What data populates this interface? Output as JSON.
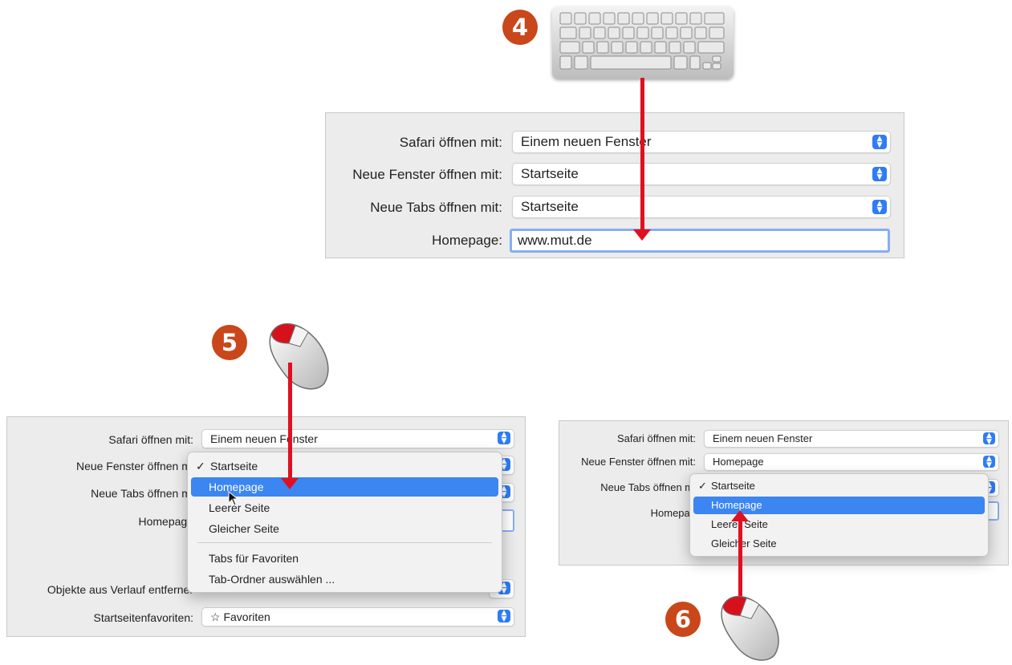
{
  "steps": {
    "four": "4",
    "five": "5",
    "six": "6"
  },
  "top_panel": {
    "rows": [
      {
        "label": "Safari öffnen mit:",
        "value": "Einem neuen Fenster"
      },
      {
        "label": "Neue Fenster öffnen mit:",
        "value": "Startseite"
      },
      {
        "label": "Neue Tabs öffnen mit:",
        "value": "Startseite"
      },
      {
        "label": "Homepage:",
        "value": "www.mut.de"
      }
    ]
  },
  "left_panel": {
    "safari_label": "Safari öffnen mit:",
    "safari_value": "Einem neuen Fenster",
    "new_windows_label": "Neue Fenster öffnen mi",
    "new_tabs_label": "Neue Tabs öffnen mi",
    "homepage_label": "Homepage",
    "history_label": "Objekte aus Verlauf entferner",
    "favorites_label": "Startseitenfavoriten:",
    "favorites_value": "Favoriten",
    "menu": {
      "items": [
        "Startseite",
        "Homepage",
        "Leerer Seite",
        "Gleicher Seite"
      ],
      "extra_items": [
        "Tabs für Favoriten",
        "Tab-Ordner auswählen ..."
      ],
      "checked": "Startseite",
      "highlighted": "Homepage"
    }
  },
  "right_panel": {
    "safari_label": "Safari öffnen mit:",
    "safari_value": "Einem neuen Fenster",
    "new_windows_label": "Neue Fenster öffnen mit:",
    "new_windows_value": "Homepage",
    "new_tabs_label": "Neue Tabs öffnen mi",
    "homepage_label": "Homepag",
    "menu": {
      "items": [
        "Startseite",
        "Homepage",
        "Leerer Seite",
        "Gleicher Seite"
      ],
      "checked": "Startseite",
      "highlighted": "Homepage"
    }
  },
  "colors": {
    "accent": "#3b86f0",
    "arrow": "#e01020",
    "badge": "#c9471a"
  },
  "icons": [
    "keyboard-icon",
    "mouse-icon",
    "star-icon",
    "checkmark-icon",
    "popup-stepper-icon",
    "pointer-cursor-icon"
  ]
}
